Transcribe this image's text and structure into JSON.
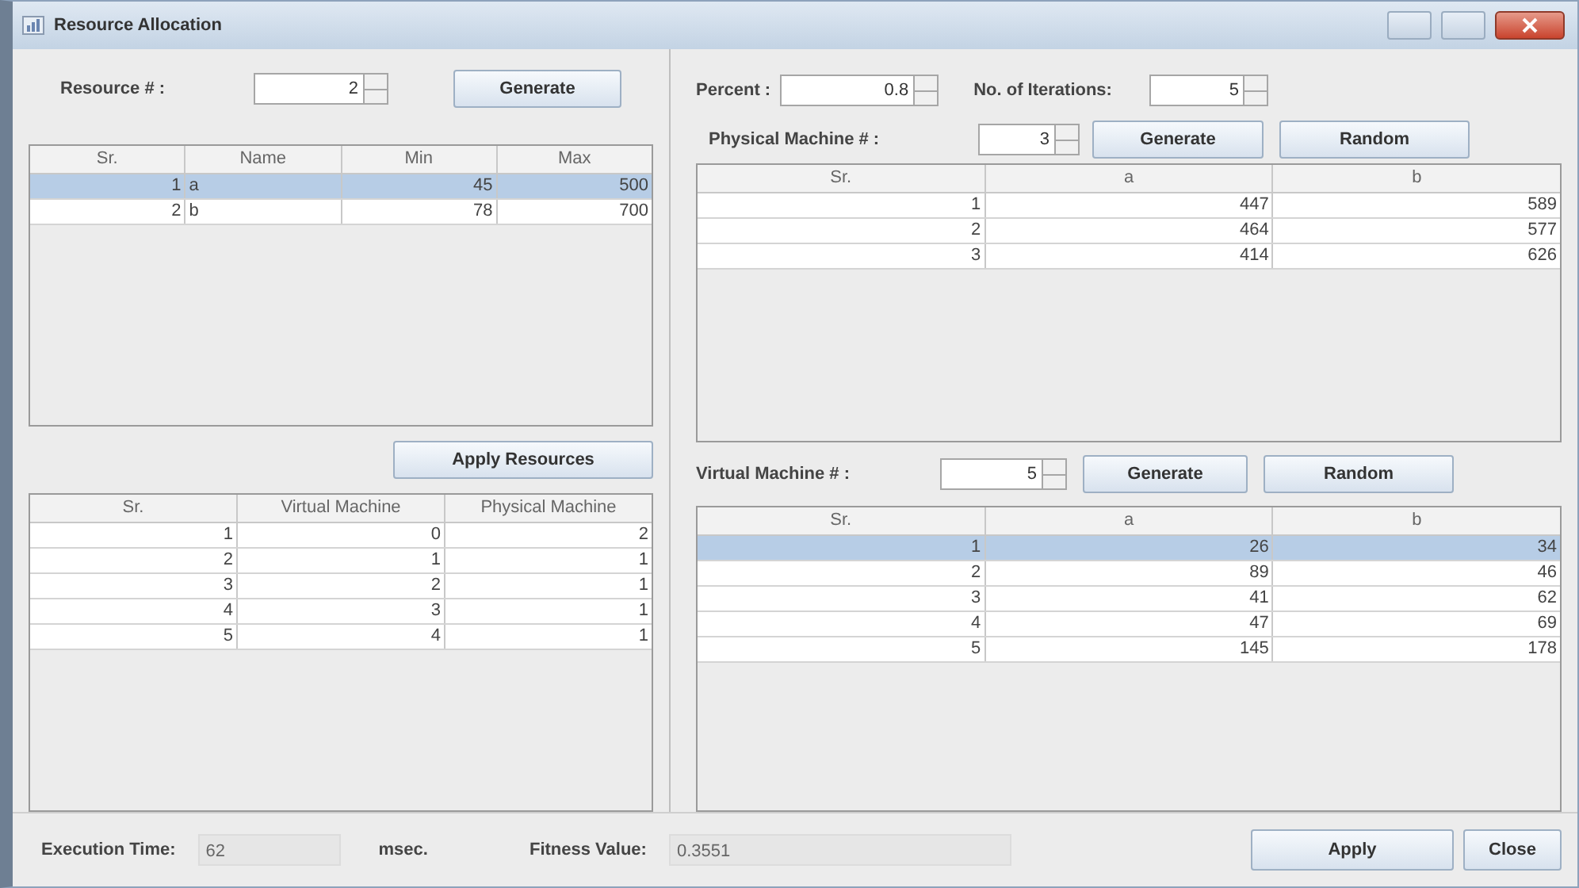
{
  "window": {
    "title": "Resource Allocation"
  },
  "resources": {
    "label": "Resource # :",
    "count": "2",
    "generate_button": "Generate",
    "table": {
      "columns": [
        {
          "label": "Sr.",
          "kind": "number"
        },
        {
          "label": "Name",
          "kind": "text"
        },
        {
          "label": "Min",
          "kind": "number"
        },
        {
          "label": "Max",
          "kind": "number"
        }
      ],
      "rows": [
        {
          "cells": [
            "1",
            "a",
            "45",
            "500"
          ],
          "selected": true
        },
        {
          "cells": [
            "2",
            "b",
            "78",
            "700"
          ],
          "selected": false
        }
      ]
    }
  },
  "apply_resources_button": "Apply Resources",
  "allocation_table": {
    "columns": [
      {
        "label": "Sr.",
        "kind": "number"
      },
      {
        "label": "Virtual Machine",
        "kind": "number"
      },
      {
        "label": "Physical Machine",
        "kind": "number"
      }
    ],
    "rows": [
      {
        "cells": [
          "1",
          "0",
          "2"
        ],
        "selected": false
      },
      {
        "cells": [
          "2",
          "1",
          "1"
        ],
        "selected": false
      },
      {
        "cells": [
          "3",
          "2",
          "1"
        ],
        "selected": false
      },
      {
        "cells": [
          "4",
          "3",
          "1"
        ],
        "selected": false
      },
      {
        "cells": [
          "5",
          "4",
          "1"
        ],
        "selected": false
      }
    ]
  },
  "percent": {
    "label": "Percent :",
    "value": "0.8"
  },
  "iterations": {
    "label": "No. of Iterations:",
    "value": "5"
  },
  "physical": {
    "label": "Physical Machine # :",
    "count": "3",
    "generate_button": "Generate",
    "random_button": "Random",
    "table": {
      "columns": [
        {
          "label": "Sr.",
          "kind": "number"
        },
        {
          "label": "a",
          "kind": "number"
        },
        {
          "label": "b",
          "kind": "number"
        }
      ],
      "rows": [
        {
          "cells": [
            "1",
            "447",
            "589"
          ],
          "selected": false
        },
        {
          "cells": [
            "2",
            "464",
            "577"
          ],
          "selected": false
        },
        {
          "cells": [
            "3",
            "414",
            "626"
          ],
          "selected": false
        }
      ]
    }
  },
  "virtual": {
    "label": "Virtual Machine # :",
    "count": "5",
    "generate_button": "Generate",
    "random_button": "Random",
    "table": {
      "columns": [
        {
          "label": "Sr.",
          "kind": "number"
        },
        {
          "label": "a",
          "kind": "number"
        },
        {
          "label": "b",
          "kind": "number"
        }
      ],
      "rows": [
        {
          "cells": [
            "1",
            "26",
            "34"
          ],
          "selected": true
        },
        {
          "cells": [
            "2",
            "89",
            "46"
          ],
          "selected": false
        },
        {
          "cells": [
            "3",
            "41",
            "62"
          ],
          "selected": false
        },
        {
          "cells": [
            "4",
            "47",
            "69"
          ],
          "selected": false
        },
        {
          "cells": [
            "5",
            "145",
            "178"
          ],
          "selected": false
        }
      ]
    }
  },
  "status": {
    "execution_label": "Execution Time:",
    "execution_value": "62",
    "execution_unit": "msec.",
    "fitness_label": "Fitness Value:",
    "fitness_value": "0.3551",
    "apply_button": "Apply",
    "close_button": "Close"
  }
}
